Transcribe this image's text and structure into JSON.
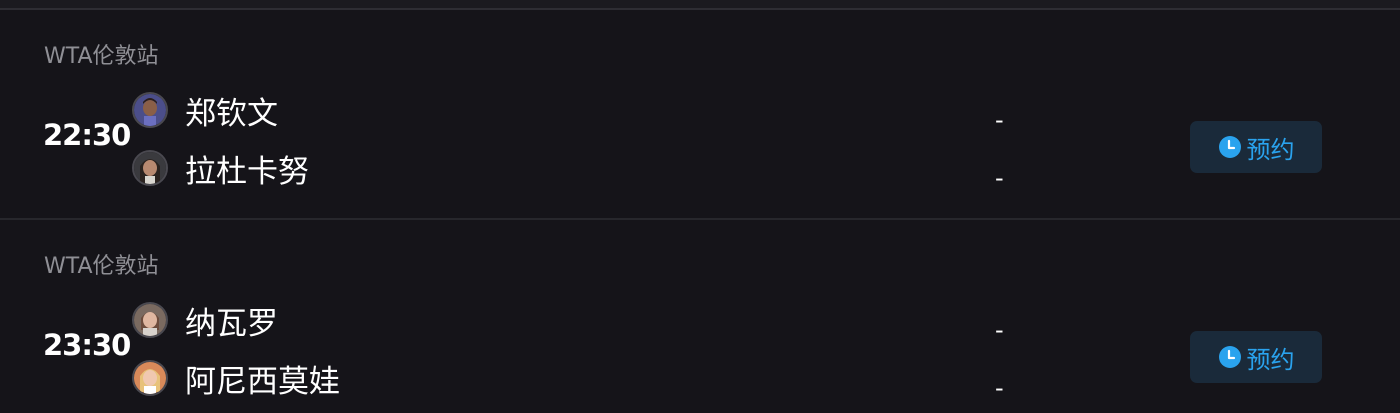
{
  "colors": {
    "page_bg": "#151419",
    "divider": "#27272c",
    "league_text": "#8f8f95",
    "accent_blue": "#2aa3ee",
    "button_bg": "#1a2a3a"
  },
  "matches": [
    {
      "league": "WTA伦敦站",
      "time": "22:30",
      "players": [
        {
          "name": "郑钦文",
          "avatar_icon": "player-avatar",
          "score": "-"
        },
        {
          "name": "拉杜卡努",
          "avatar_icon": "player-avatar",
          "score": "-"
        }
      ],
      "action": {
        "label": "预约",
        "icon": "clock-icon"
      }
    },
    {
      "league": "WTA伦敦站",
      "time": "23:30",
      "players": [
        {
          "name": "纳瓦罗",
          "avatar_icon": "player-avatar",
          "score": "-"
        },
        {
          "name": "阿尼西莫娃",
          "avatar_icon": "player-avatar",
          "score": "-"
        }
      ],
      "action": {
        "label": "预约",
        "icon": "clock-icon"
      }
    }
  ]
}
